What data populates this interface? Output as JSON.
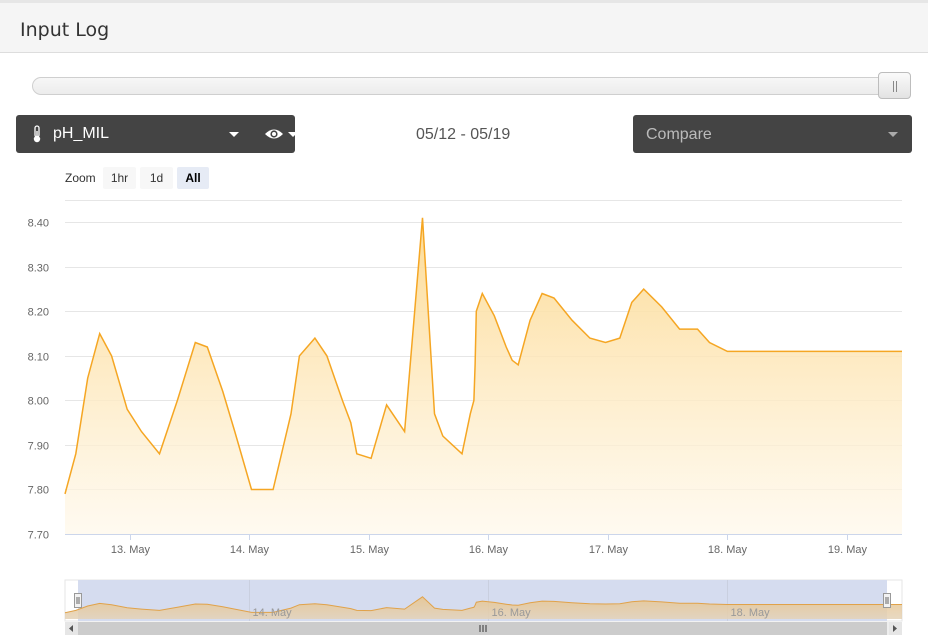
{
  "header": {
    "title": "Input Log"
  },
  "input_selector": {
    "label": "pH_MIL",
    "icon": "thermometer-icon",
    "visibility_icon": "eye-icon"
  },
  "date_range": "05/12 - 05/19",
  "compare": {
    "placeholder": "Compare"
  },
  "zoom": {
    "label": "Zoom",
    "buttons": [
      "1hr",
      "1d",
      "All"
    ],
    "active": "All"
  },
  "range_selector": {
    "position_fraction": 1.0
  },
  "colors": {
    "series": "#f5a623",
    "fill_top": "#fcd990",
    "navigator_mask": "#d5dcef",
    "dropdown_bg": "#444444"
  },
  "chart_data": {
    "type": "area",
    "ylim": [
      7.7,
      8.45
    ],
    "yticks": [
      "7.70",
      "7.80",
      "7.90",
      "8.00",
      "8.10",
      "8.20",
      "8.30",
      "8.40"
    ],
    "xticks": [
      "13. May",
      "14. May",
      "15. May",
      "16. May",
      "17. May",
      "18. May",
      "19. May"
    ],
    "navigator_xticks": [
      "14. May",
      "16. May",
      "18. May"
    ],
    "x_unit": "days since 12. May 00:00",
    "xlim": [
      12.46,
      19.46
    ],
    "x": [
      12.46,
      12.55,
      12.65,
      12.75,
      12.85,
      12.98,
      13.1,
      13.25,
      13.4,
      13.55,
      13.65,
      13.78,
      13.88,
      14.02,
      14.2,
      14.35,
      14.42,
      14.55,
      14.65,
      14.78,
      14.85,
      14.9,
      15.02,
      15.15,
      15.3,
      15.45,
      15.55,
      15.62,
      15.7,
      15.78,
      15.85,
      15.88,
      15.89,
      15.9,
      15.95,
      16.05,
      16.15,
      16.2,
      16.25,
      16.35,
      16.45,
      16.55,
      16.7,
      16.85,
      16.98,
      17.1,
      17.2,
      17.3,
      17.45,
      17.6,
      17.75,
      17.85,
      18.0,
      18.1,
      18.25,
      18.4,
      18.55,
      18.65,
      18.75,
      18.85,
      18.95,
      19.05,
      19.2,
      19.35,
      19.46
    ],
    "values": [
      7.79,
      7.88,
      8.05,
      8.15,
      8.1,
      7.98,
      7.93,
      7.88,
      8.0,
      8.13,
      8.12,
      8.02,
      7.93,
      7.8,
      7.8,
      7.97,
      8.1,
      8.14,
      8.1,
      8.0,
      7.95,
      7.88,
      7.87,
      7.99,
      7.93,
      8.41,
      7.97,
      7.92,
      7.9,
      7.88,
      7.97,
      8.0,
      8.08,
      8.2,
      8.24,
      8.19,
      8.12,
      8.09,
      8.08,
      8.18,
      8.24,
      8.23,
      8.18,
      8.14,
      8.13,
      8.14,
      8.22,
      8.25,
      8.21,
      8.16,
      8.16,
      8.13,
      8.11,
      8.11,
      8.11,
      8.11,
      8.11,
      8.11,
      8.11,
      8.11,
      8.11,
      8.11,
      8.11,
      8.11,
      8.11
    ]
  }
}
